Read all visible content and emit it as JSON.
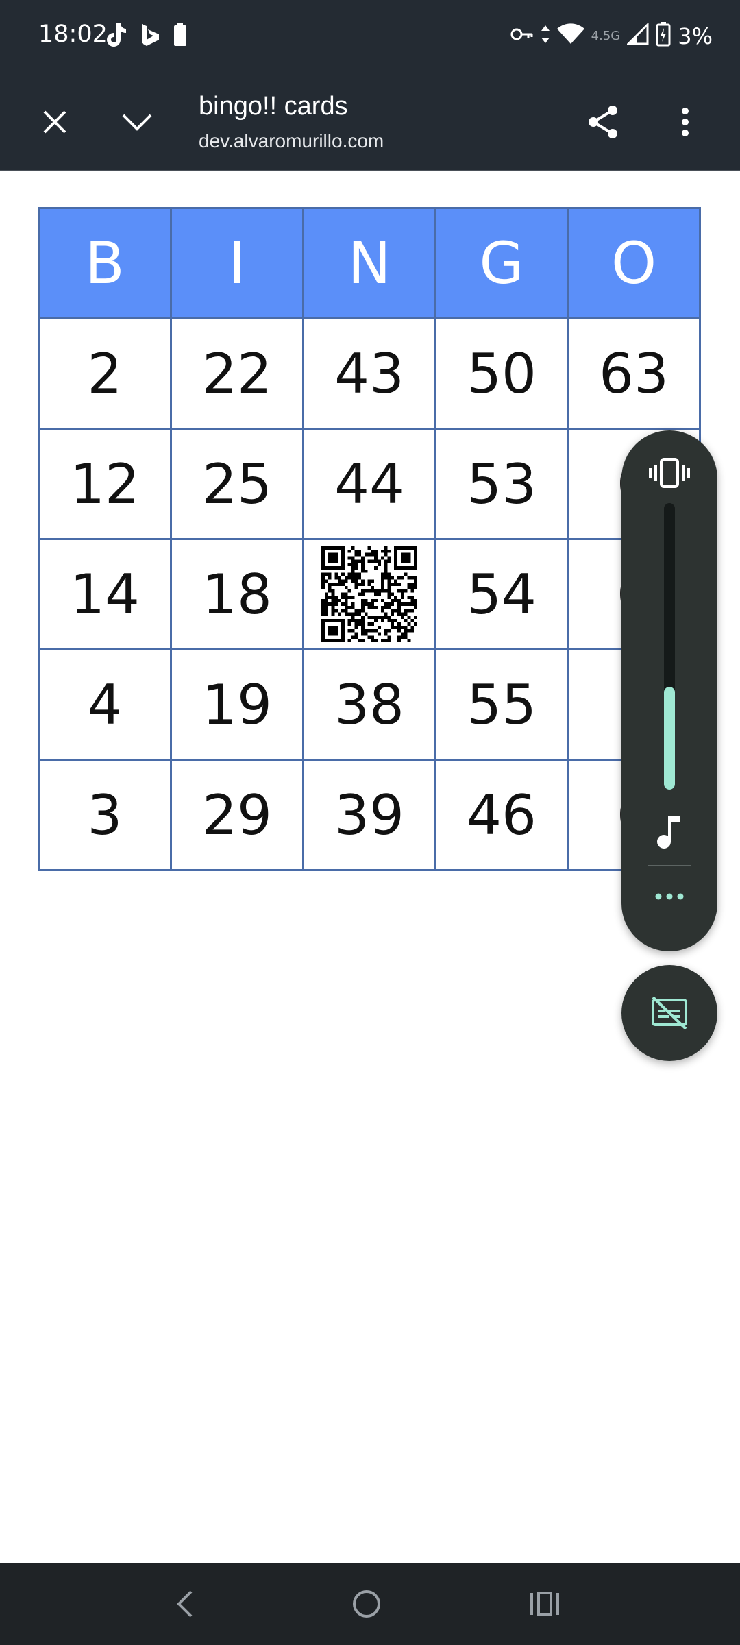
{
  "status_bar": {
    "time": "18:02",
    "network_label": "4.5G",
    "battery_percent": "3%",
    "icons": [
      "tiktok-icon",
      "bing-icon",
      "battery-saver-icon",
      "vpn-key-icon",
      "data-arrows-icon",
      "wifi-icon",
      "signal-icon",
      "battery-charging-icon"
    ]
  },
  "toolbar": {
    "title": "bingo!! cards",
    "url": "dev.alvaromurillo.com",
    "icons": [
      "close-icon",
      "chevron-down-icon",
      "share-icon",
      "more-vert-icon"
    ]
  },
  "bingo": {
    "headers": [
      "B",
      "I",
      "N",
      "G",
      "O"
    ],
    "rows": [
      [
        "2",
        "22",
        "43",
        "50",
        "63"
      ],
      [
        "12",
        "25",
        "44",
        "53",
        "6"
      ],
      [
        "14",
        "18",
        "",
        "54",
        "6"
      ],
      [
        "4",
        "19",
        "38",
        "55",
        "7"
      ],
      [
        "3",
        "29",
        "39",
        "46",
        "6"
      ]
    ],
    "free_space": "qr-code",
    "colors": {
      "header_bg": "#5b8ff9",
      "border": "#4a6ca8"
    }
  },
  "volume_panel": {
    "level_fraction": 0.36,
    "accent_color": "#9fe8d3",
    "icons": [
      "vibrate-icon",
      "music-note-icon",
      "more-horiz-icon"
    ]
  },
  "live_caption": {
    "icon": "captions-off-icon"
  },
  "nav_bar": {
    "icons": [
      "back-icon",
      "home-icon",
      "recents-icon"
    ]
  }
}
